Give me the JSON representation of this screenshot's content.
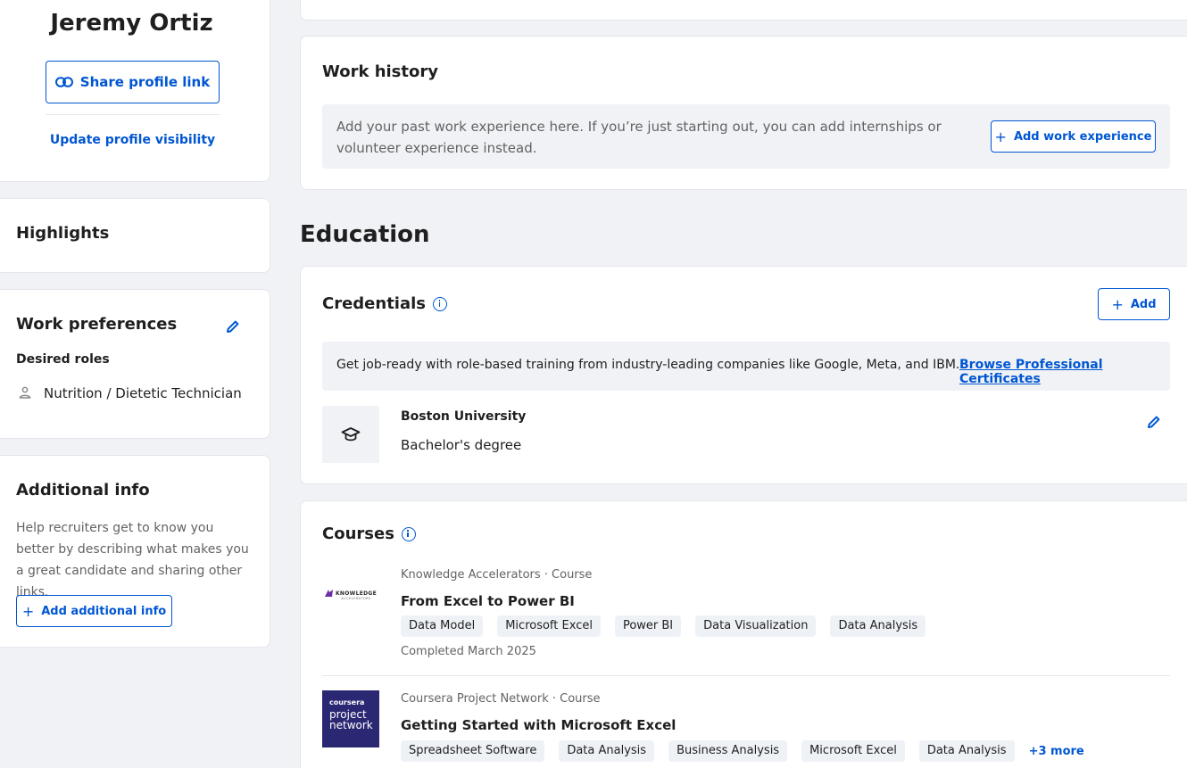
{
  "profile": {
    "name": "Jeremy Ortiz",
    "share_label": "Share profile link",
    "visibility_label": "Update profile visibility"
  },
  "highlights": {
    "title": "Highlights"
  },
  "work_preferences": {
    "title": "Work preferences",
    "desired_roles_label": "Desired roles",
    "role": "Nutrition / Dietetic Technician"
  },
  "additional_info": {
    "title": "Additional info",
    "description": "Help recruiters get to know you better by describing what makes you a great candidate and sharing other links.",
    "add_label": "Add additional info"
  },
  "work_history": {
    "title": "Work history",
    "prompt": "Add your past work experience here. If you’re just starting out, you can add internships or volunteer experience instead.",
    "add_label": "Add work experience"
  },
  "education": {
    "title": "Education",
    "credentials": {
      "title": "Credentials",
      "add_label": "Add",
      "banner_text": "Get job-ready with role-based training from industry-leading companies like Google, Meta, and IBM.",
      "banner_link": "Browse Professional Certificates",
      "items": [
        {
          "school": "Boston University",
          "degree": "Bachelor's degree"
        }
      ]
    }
  },
  "courses": {
    "title": "Courses",
    "items": [
      {
        "provider": "Knowledge Accelerators · Course",
        "logo_text": "KNOWLEDGE",
        "logo_subtext": "ACCELERATORS",
        "name": "From Excel to Power BI",
        "skills": [
          "Data Model",
          "Microsoft Excel",
          "Power BI",
          "Data Visualization",
          "Data Analysis"
        ],
        "completed": "Completed March 2025"
      },
      {
        "provider": "Coursera Project Network · Course",
        "logo_text": "coursera",
        "logo_subtext_1": "project",
        "logo_subtext_2": "network",
        "name": "Getting Started with Microsoft Excel",
        "skills": [
          "Spreadsheet Software",
          "Data Analysis",
          "Business Analysis",
          "Microsoft Excel",
          "Data Analysis"
        ],
        "more_label": "+3 more"
      }
    ]
  },
  "colors": {
    "accent": "#0056d2",
    "page_bg": "#f0f2f6",
    "coursera_logo_bg": "#2a2773"
  }
}
